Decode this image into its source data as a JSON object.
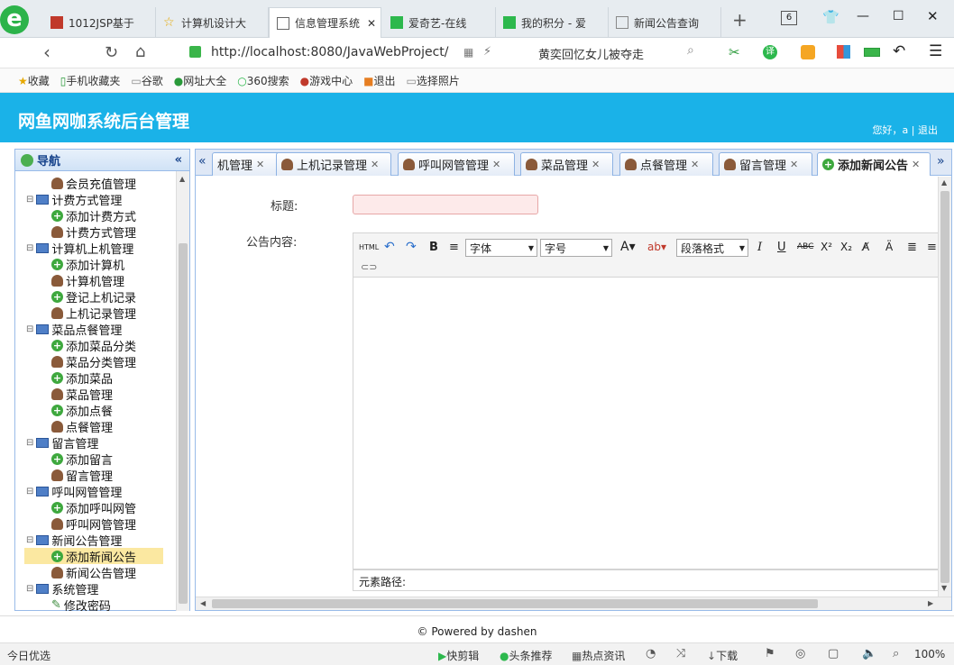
{
  "browser": {
    "tabs": [
      {
        "title": "1012JSP基于"
      },
      {
        "title": "计算机设计大"
      },
      {
        "title": "信息管理系统"
      },
      {
        "title": "爱奇艺-在线"
      },
      {
        "title": "我的积分 - 爱"
      },
      {
        "title": "新闻公告查询"
      }
    ],
    "tab_count": "6",
    "url": "http://localhost:8080/JavaWebProject/",
    "search_text": "黄奕回忆女儿被夺走",
    "bookmarks": [
      "收藏",
      "手机收藏夹",
      "谷歌",
      "网址大全",
      "360搜索",
      "游戏中心",
      "退出",
      "选择照片"
    ]
  },
  "app": {
    "title": "网鱼网咖系统后台管理",
    "user_text": "您好，a",
    "logout": "退出",
    "nav_title": "导航",
    "tree": [
      {
        "label": "会员充值管理",
        "icon": "user-icon",
        "level": 2
      },
      {
        "label": "计费方式管理",
        "icon": "pc-icon",
        "level": 1
      },
      {
        "label": "添加计费方式",
        "icon": "add-icon",
        "level": 2
      },
      {
        "label": "计费方式管理",
        "icon": "user-icon",
        "level": 2
      },
      {
        "label": "计算机上机管理",
        "icon": "pc-icon",
        "level": 1
      },
      {
        "label": "添加计算机",
        "icon": "add-icon",
        "level": 2
      },
      {
        "label": "计算机管理",
        "icon": "user-icon",
        "level": 2
      },
      {
        "label": "登记上机记录",
        "icon": "add-icon",
        "level": 2
      },
      {
        "label": "上机记录管理",
        "icon": "user-icon",
        "level": 2
      },
      {
        "label": "菜品点餐管理",
        "icon": "pc-icon",
        "level": 1
      },
      {
        "label": "添加菜品分类",
        "icon": "add-icon",
        "level": 2
      },
      {
        "label": "菜品分类管理",
        "icon": "user-icon",
        "level": 2
      },
      {
        "label": "添加菜品",
        "icon": "add-icon",
        "level": 2
      },
      {
        "label": "菜品管理",
        "icon": "user-icon",
        "level": 2
      },
      {
        "label": "添加点餐",
        "icon": "add-icon",
        "level": 2
      },
      {
        "label": "点餐管理",
        "icon": "user-icon",
        "level": 2
      },
      {
        "label": "留言管理",
        "icon": "pc-icon",
        "level": 1
      },
      {
        "label": "添加留言",
        "icon": "add-icon",
        "level": 2
      },
      {
        "label": "留言管理",
        "icon": "user-icon",
        "level": 2
      },
      {
        "label": "呼叫网管管理",
        "icon": "pc-icon",
        "level": 1
      },
      {
        "label": "添加呼叫网管",
        "icon": "add-icon",
        "level": 2
      },
      {
        "label": "呼叫网管管理",
        "icon": "user-icon",
        "level": 2
      },
      {
        "label": "新闻公告管理",
        "icon": "pc-icon",
        "level": 1
      },
      {
        "label": "添加新闻公告",
        "icon": "add-icon",
        "level": 2,
        "selected": true
      },
      {
        "label": "新闻公告管理",
        "icon": "user-icon",
        "level": 2
      },
      {
        "label": "系统管理",
        "icon": "pc-icon",
        "level": 1
      },
      {
        "label": "修改密码",
        "icon": "pencil-icon",
        "level": 2
      }
    ],
    "page_tabs": [
      {
        "label": "机管理"
      },
      {
        "label": "上机记录管理"
      },
      {
        "label": "呼叫网管管理"
      },
      {
        "label": "菜品管理"
      },
      {
        "label": "点餐管理"
      },
      {
        "label": "留言管理"
      },
      {
        "label": "添加新闻公告",
        "active": true
      }
    ],
    "form": {
      "title_label": "标题:",
      "content_label": "公告内容:",
      "font_select": "字体",
      "size_select": "字号",
      "para_select": "段落格式",
      "element_path": "元素路径:"
    },
    "footer": "© Powered by dashen"
  },
  "statusbar": {
    "left": "今日优选",
    "items": [
      "快剪辑",
      "头条推荐",
      "热点资讯",
      "下载"
    ],
    "zoom": "100%"
  }
}
